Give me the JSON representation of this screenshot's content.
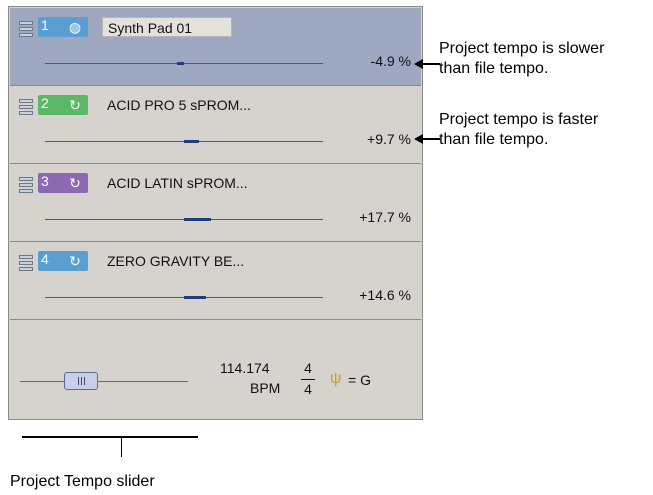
{
  "tracks": [
    {
      "number": "1",
      "name": "Synth Pad 01",
      "icon": "tempo-dial-icon",
      "tag_color": "#5a9fd2",
      "percent": "-4.9 %",
      "selected": true,
      "offset": -0.049
    },
    {
      "number": "2",
      "name": "ACID PRO 5 sPROM...",
      "icon": "loop-icon",
      "tag_color": "#5ab866",
      "percent": "+9.7 %",
      "selected": false,
      "offset": 0.097
    },
    {
      "number": "3",
      "name": "ACID LATIN sPROM...",
      "icon": "loop-icon",
      "tag_color": "#8f68b4",
      "percent": "+17.7 %",
      "selected": false,
      "offset": 0.177
    },
    {
      "number": "4",
      "name": "ZERO GRAVITY BE...",
      "icon": "loop-icon",
      "tag_color": "#5a9fd2",
      "percent": "+14.6 %",
      "selected": false,
      "offset": 0.146
    }
  ],
  "master": {
    "tempo_value": "114.174",
    "tempo_unit": "BPM",
    "sig_top": "4",
    "sig_bottom": "4",
    "key": "= G"
  },
  "annotations": {
    "slower": [
      "Project tempo is slower",
      "than file tempo."
    ],
    "faster": [
      "Project tempo is faster",
      "than file tempo."
    ],
    "slider_label": "Project Tempo slider"
  }
}
